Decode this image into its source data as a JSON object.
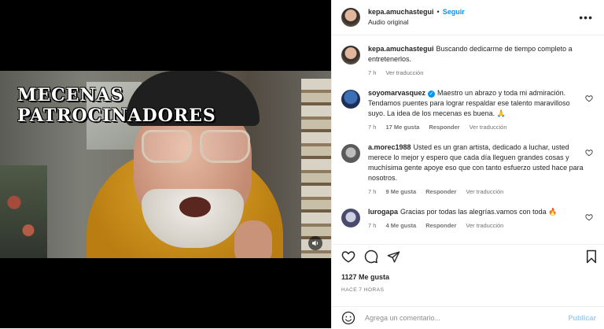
{
  "video": {
    "overlay_lines": [
      "MECENAS",
      "PATROCINADORES"
    ]
  },
  "header": {
    "username": "kepa.amuchastegui",
    "separator": "•",
    "follow_label": "Seguir",
    "audio_label": "Audio original",
    "more_label": "•••"
  },
  "caption": {
    "username": "kepa.amuchastegui",
    "text": "Buscando dedicarme de tiempo completo a entretenerlos.",
    "time": "7 h",
    "translate": "Ver traducción"
  },
  "comments": [
    {
      "username": "soyomarvasquez",
      "verified": true,
      "text": "Maestro un abrazo y toda mi admiración. Tendamos puentes para lograr respaldar ese talento maravilloso suyo. La idea de los mecenas es buena. 🙏",
      "time": "7 h",
      "likes": "17 Me gusta",
      "reply": "Responder",
      "translate": "Ver traducción"
    },
    {
      "username": "a.morec1988",
      "verified": false,
      "text": "Usted es un gran artista, dedicado a luchar, usted merece lo mejor y espero que cada día lleguen grandes cosas y muchísima gente apoye eso que con tanto esfuerzo usted hace para nosotros.",
      "time": "7 h",
      "likes": "9 Me gusta",
      "reply": "Responder",
      "translate": "Ver traducción"
    },
    {
      "username": "lurogapa",
      "verified": false,
      "text": "Gracias por todas las alegrías.vamos con toda 🔥",
      "time": "7 h",
      "likes": "4 Me gusta",
      "reply": "Responder",
      "translate": "Ver traducción"
    }
  ],
  "footer": {
    "likes": "1127 Me gusta",
    "ago": "HACE 7 HORAS",
    "comment_placeholder": "Agrega un comentario...",
    "publish_label": "Publicar"
  }
}
